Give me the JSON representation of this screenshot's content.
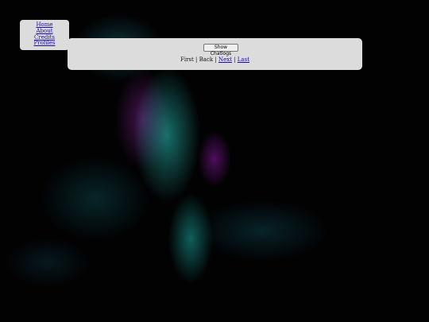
{
  "nav": {
    "items": [
      {
        "label": "Home"
      },
      {
        "label": "About"
      },
      {
        "label": "Credits"
      },
      {
        "label": "Profiles"
      }
    ]
  },
  "main": {
    "show_button_label": "Show Chatlogs",
    "pager": {
      "first": "First",
      "back": "Back",
      "next": "Next",
      "last": "Last",
      "separator": " | "
    }
  }
}
